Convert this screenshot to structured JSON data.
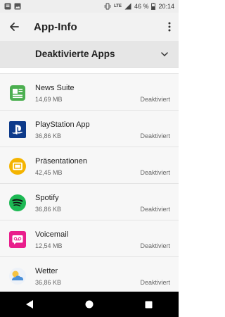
{
  "status_bar": {
    "left_icons": [
      "notification-icon",
      "image-icon"
    ],
    "right_icons": [
      "vibrate-icon",
      "lte-signal-icon",
      "signal-icon",
      "battery-icon"
    ],
    "network": "LTE",
    "battery": "46 %",
    "time": "20:14"
  },
  "app_bar": {
    "title": "App-Info",
    "back_icon": "arrow-back-icon",
    "menu_icon": "more-vert-icon"
  },
  "filter": {
    "label": "Deaktivierte Apps",
    "chevron_icon": "chevron-down-icon"
  },
  "apps": [
    {
      "name": "News Suite",
      "size": "14,69 MB",
      "status": "Deaktiviert",
      "icon": "news-suite-icon"
    },
    {
      "name": "PlayStation App",
      "size": "36,86 KB",
      "status": "Deaktiviert",
      "icon": "playstation-icon"
    },
    {
      "name": "Präsentationen",
      "size": "42,45 MB",
      "status": "Deaktiviert",
      "icon": "presentations-icon"
    },
    {
      "name": "Spotify",
      "size": "36,86 KB",
      "status": "Deaktiviert",
      "icon": "spotify-icon"
    },
    {
      "name": "Voicemail",
      "size": "12,54 MB",
      "status": "Deaktiviert",
      "icon": "voicemail-icon"
    },
    {
      "name": "Wetter",
      "size": "36,86 KB",
      "status": "Deaktiviert",
      "icon": "weather-icon"
    }
  ],
  "colors": {
    "news_suite": "#4caf50",
    "playstation": "#0d3a8a",
    "presentations": "#f4b400",
    "spotify": "#1db954",
    "voicemail": "#e91e8c",
    "weather": "#4a90d9"
  },
  "nav_bar": {
    "back_icon": "nav-back-icon",
    "home_icon": "nav-home-icon",
    "recents_icon": "nav-recents-icon"
  }
}
